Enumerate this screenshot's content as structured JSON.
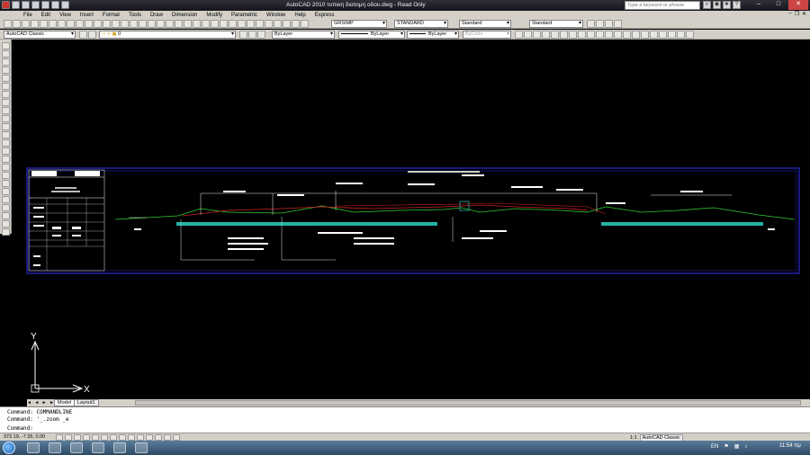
{
  "window": {
    "title": "AutoCAD 2010     τυπικη διατομη οδου.dwg - Read Only",
    "search_placeholder": "Type a keyword or phrase"
  },
  "menu": [
    "File",
    "Edit",
    "View",
    "Insert",
    "Format",
    "Tools",
    "Draw",
    "Dimension",
    "Modify",
    "Parametric",
    "Window",
    "Help",
    "Express"
  ],
  "toolbar1": {
    "text_style": "GRSIMP",
    "dim_style": "STANDARD",
    "table_style": "Standard",
    "mleader_style": "Standard"
  },
  "toolbar2": {
    "workspace": "AutoCAD Classic",
    "layer": "0",
    "color": "ByLayer",
    "linetype": "ByLayer",
    "lineweight": "ByLayer",
    "plotstyle": "ByColor"
  },
  "axis_icon": {
    "x_label": "X",
    "y_label": "Y"
  },
  "tabs": {
    "model": "Model",
    "layout": "Layout1",
    "nav": "◄ ◄ ► ►"
  },
  "command": {
    "line1": "Command: COMMANDLINE",
    "line2": "Command: '_.zoom _e",
    "prompt": "Command:"
  },
  "status": {
    "coords": "372.19, -7.35, 0.00",
    "scale": "1:1",
    "workspace": "AutoCAD Classic"
  },
  "taskbar": {
    "lang": "EN",
    "time": "11:54 πμ"
  },
  "colors": {
    "canvas": "#000000",
    "frame": "#2222aa",
    "ground_fill": "#26c6b8",
    "ground_line": "#33cc33",
    "profile_red": "#cc2222"
  }
}
